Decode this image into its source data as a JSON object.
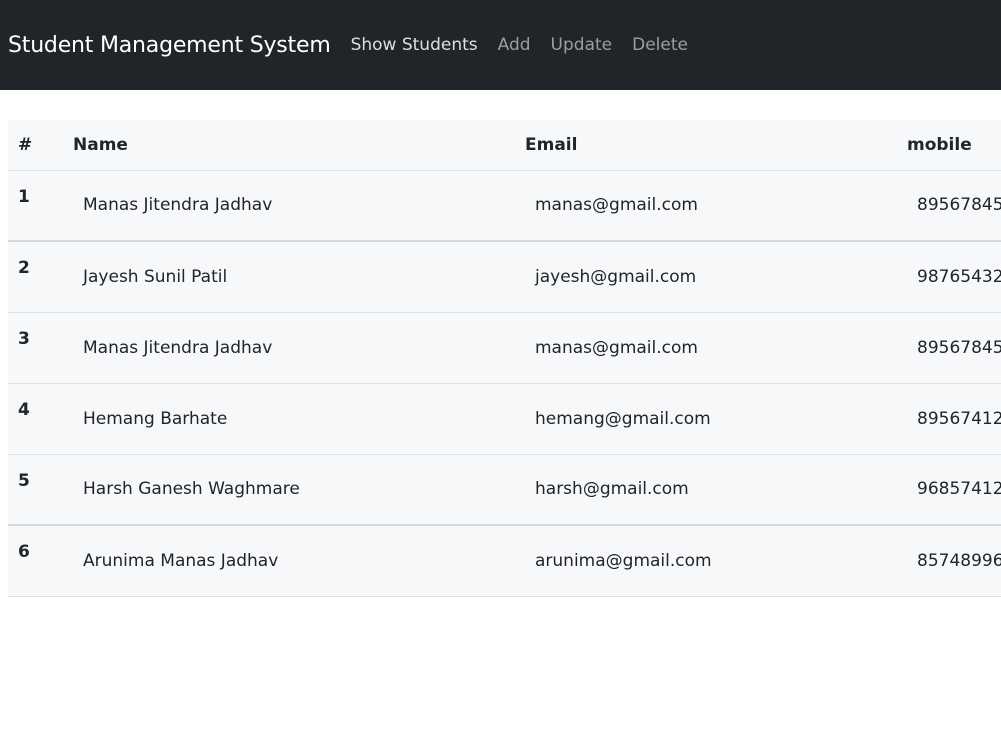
{
  "navbar": {
    "brand": "Student Management System",
    "links": [
      {
        "label": "Show Students",
        "active": true
      },
      {
        "label": "Add",
        "active": false
      },
      {
        "label": "Update",
        "active": false
      },
      {
        "label": "Delete",
        "active": false
      }
    ]
  },
  "table": {
    "headers": [
      "#",
      "Name",
      "Email",
      "mobile"
    ],
    "rows": [
      {
        "id": "1",
        "name": "Manas Jitendra Jadhav",
        "email": "manas@gmail.com",
        "mobile": "89567845"
      },
      {
        "id": "2",
        "name": "Jayesh Sunil Patil",
        "email": "jayesh@gmail.com",
        "mobile": "98765432"
      },
      {
        "id": "3",
        "name": "Manas Jitendra Jadhav",
        "email": "manas@gmail.com",
        "mobile": "89567845"
      },
      {
        "id": "4",
        "name": "Hemang Barhate",
        "email": "hemang@gmail.com",
        "mobile": "89567412"
      },
      {
        "id": "5",
        "name": "Harsh Ganesh Waghmare",
        "email": "harsh@gmail.com",
        "mobile": "96857412"
      },
      {
        "id": "6",
        "name": "Arunima Manas Jadhav",
        "email": "arunima@gmail.com",
        "mobile": "85748996"
      }
    ]
  },
  "colors": {
    "navbar_bg": "#212529",
    "table_bg": "#f7f8f9",
    "border": "#dee2e6"
  }
}
